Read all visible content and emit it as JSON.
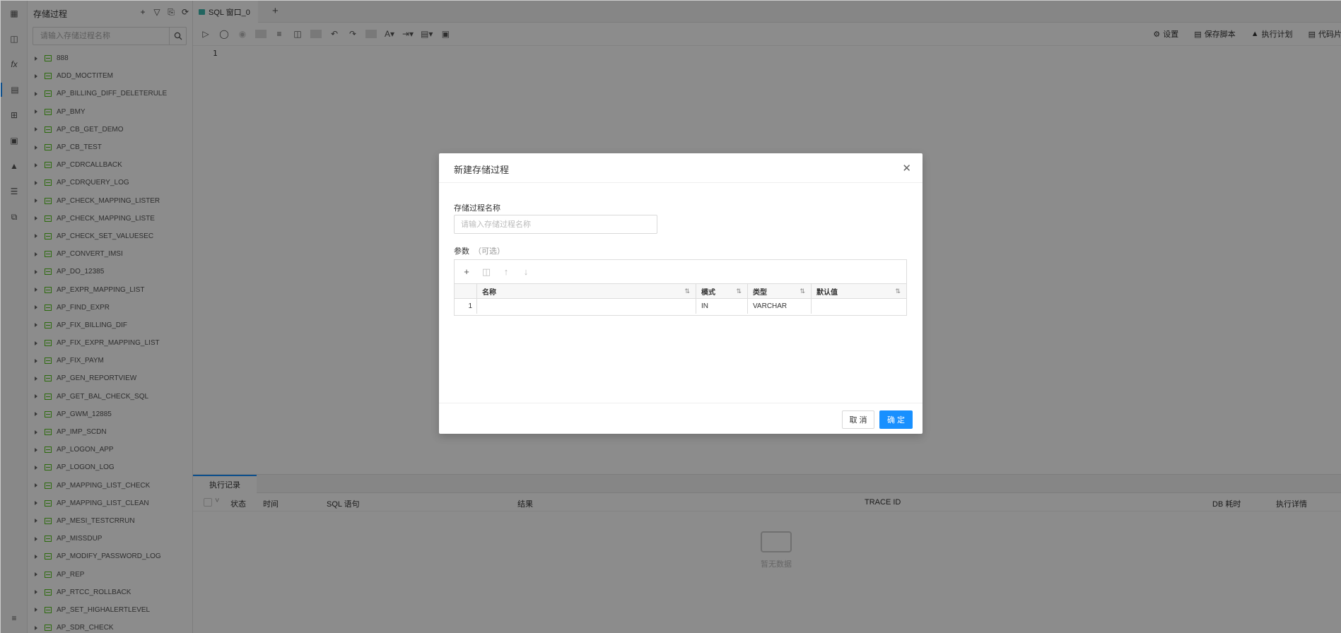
{
  "rail": {
    "icons": [
      "table-icon",
      "view-icon",
      "function-icon",
      "procedure-icon",
      "grid-icon",
      "package-icon",
      "trigger-icon",
      "list-icon",
      "sequence-icon",
      "menu-icon"
    ]
  },
  "sidebar": {
    "title": "存储过程",
    "search_placeholder": "请输入存储过程名称",
    "items": [
      "888",
      "ADD_MOCTITEM",
      "AP_BILLING_DIFF_DELETERULE",
      "AP_BMY",
      "AP_CB_GET_DEMO",
      "AP_CB_TEST",
      "AP_CDRCALLBACK",
      "AP_CDRQUERY_LOG",
      "AP_CHECK_MAPPING_LISTER",
      "AP_CHECK_MAPPING_LISTE",
      "AP_CHECK_SET_VALUESEC",
      "AP_CONVERT_IMSI",
      "AP_DO_12385",
      "AP_EXPR_MAPPING_LIST",
      "AP_FIND_EXPR",
      "AP_FIX_BILLING_DIF",
      "AP_FIX_EXPR_MAPPING_LIST",
      "AP_FIX_PAYM",
      "AP_GEN_REPORTVIEW",
      "AP_GET_BAL_CHECK_SQL",
      "AP_GWM_12885",
      "AP_IMP_SCDN",
      "AP_LOGON_APP",
      "AP_LOGON_LOG",
      "AP_MAPPING_LIST_CHECK",
      "AP_MAPPING_LIST_CLEAN",
      "AP_MESI_TESTCRRUN",
      "AP_MISSDUP",
      "AP_MODIFY_PASSWORD_LOG",
      "AP_REP",
      "AP_RTCC_ROLLBACK",
      "AP_SET_HIGHALERTLEVEL",
      "AP_SDR_CHECK"
    ]
  },
  "tabs": {
    "active_label": "SQL 窗口_0",
    "add_label": "+"
  },
  "toolbar": {
    "settings": "设置",
    "save_script": "保存脚本",
    "exec_plan": "执行计划",
    "code_snippet": "代码片"
  },
  "editor": {
    "line_number": "1"
  },
  "bottom": {
    "tab_label": "执行记录",
    "columns": {
      "status": "状态",
      "time": "时间",
      "sql": "SQL 语句",
      "result": "结果",
      "trace": "TRACE ID",
      "db_time": "DB 耗时",
      "details": "执行详情"
    },
    "empty_text": "暂无数据"
  },
  "modal": {
    "title": "新建存储过程",
    "name_label": "存储过程名称",
    "name_placeholder": "请输入存储过程名称",
    "params_label": "参数",
    "params_optional": "（可选）",
    "table": {
      "headers": {
        "name": "名称",
        "mode": "模式",
        "type": "类型",
        "default": "默认值"
      },
      "rows": [
        {
          "index": "1",
          "name": "",
          "mode": "IN",
          "type": "VARCHAR",
          "default": ""
        }
      ]
    },
    "cancel_label": "取 消",
    "ok_label": "确 定"
  }
}
